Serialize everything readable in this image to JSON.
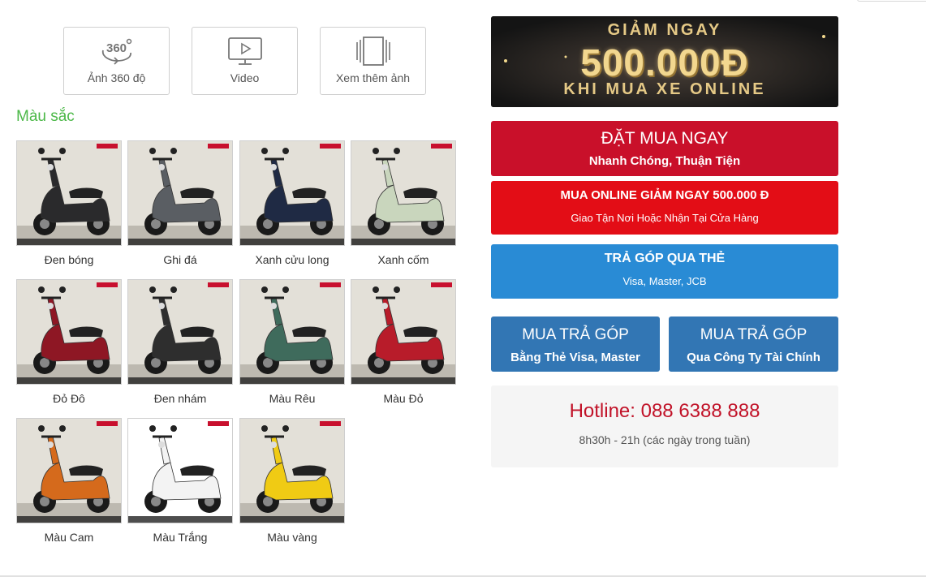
{
  "media_buttons": [
    {
      "label": "Ảnh 360 độ",
      "icon": "rotate-360-icon"
    },
    {
      "label": "Video",
      "icon": "video-monitor-icon"
    },
    {
      "label": "Xem thêm ảnh",
      "icon": "gallery-icon"
    }
  ],
  "colors_section": {
    "title": "Màu sắc",
    "title_color": "#4cb848",
    "items": [
      {
        "name": "Đen bóng",
        "body_color": "#2a2a2c",
        "bg": "#e3e0d8"
      },
      {
        "name": "Ghi đá",
        "body_color": "#5a5e63",
        "bg": "#e3e0d8"
      },
      {
        "name": "Xanh cửu long",
        "body_color": "#1f2a44",
        "bg": "#e3e0d8"
      },
      {
        "name": "Xanh cốm",
        "body_color": "#c9d6bd",
        "bg": "#e3e0d8"
      },
      {
        "name": "Đỏ Đô",
        "body_color": "#8e1724",
        "bg": "#e3e0d8"
      },
      {
        "name": "Đen nhám",
        "body_color": "#2e2e2e",
        "bg": "#e3e0d8"
      },
      {
        "name": "Màu Rêu",
        "body_color": "#3f6b5c",
        "bg": "#e3e0d8"
      },
      {
        "name": "Màu Đỏ",
        "body_color": "#b81c2a",
        "bg": "#e3e0d8"
      },
      {
        "name": "Màu Cam",
        "body_color": "#d56a1c",
        "bg": "#e3e0d8"
      },
      {
        "name": "Màu Trắng",
        "body_color": "#f3f3f3",
        "bg": "#ffffff"
      },
      {
        "name": "Màu vàng",
        "body_color": "#f0cb14",
        "bg": "#e3e0d8"
      }
    ]
  },
  "promo_banner": {
    "line1": "GIẢM NGAY",
    "line2": "500.000Đ",
    "line3": "KHI MUA XE ONLINE"
  },
  "cta_buttons": {
    "order_now": {
      "title": "ĐẶT MUA NGAY",
      "subtitle": "Nhanh Chóng, Thuận Tiện",
      "color": "#c9102a"
    },
    "online": {
      "title": "MUA ONLINE GIẢM NGAY 500.000 Đ",
      "subtitle": "Giao Tận Nơi Hoặc Nhận Tại Cửa Hàng",
      "color": "#e30d16"
    },
    "card_installment": {
      "title": "TRẢ GÓP QUA THẺ",
      "subtitle": "Visa, Master, JCB",
      "color": "#298bd5"
    },
    "installment_visa": {
      "title": "MUA TRẢ GÓP",
      "subtitle": "Bằng Thẻ Visa, Master",
      "color": "#3276b4"
    },
    "installment_finance": {
      "title": "MUA TRẢ GÓP",
      "subtitle": "Qua Công Ty Tài Chính",
      "color": "#3276b4"
    }
  },
  "hotline": {
    "label": "Hotline: 088 6388 888",
    "hours": "8h30h - 21h (các ngày trong tuần)",
    "color": "#c11228"
  }
}
